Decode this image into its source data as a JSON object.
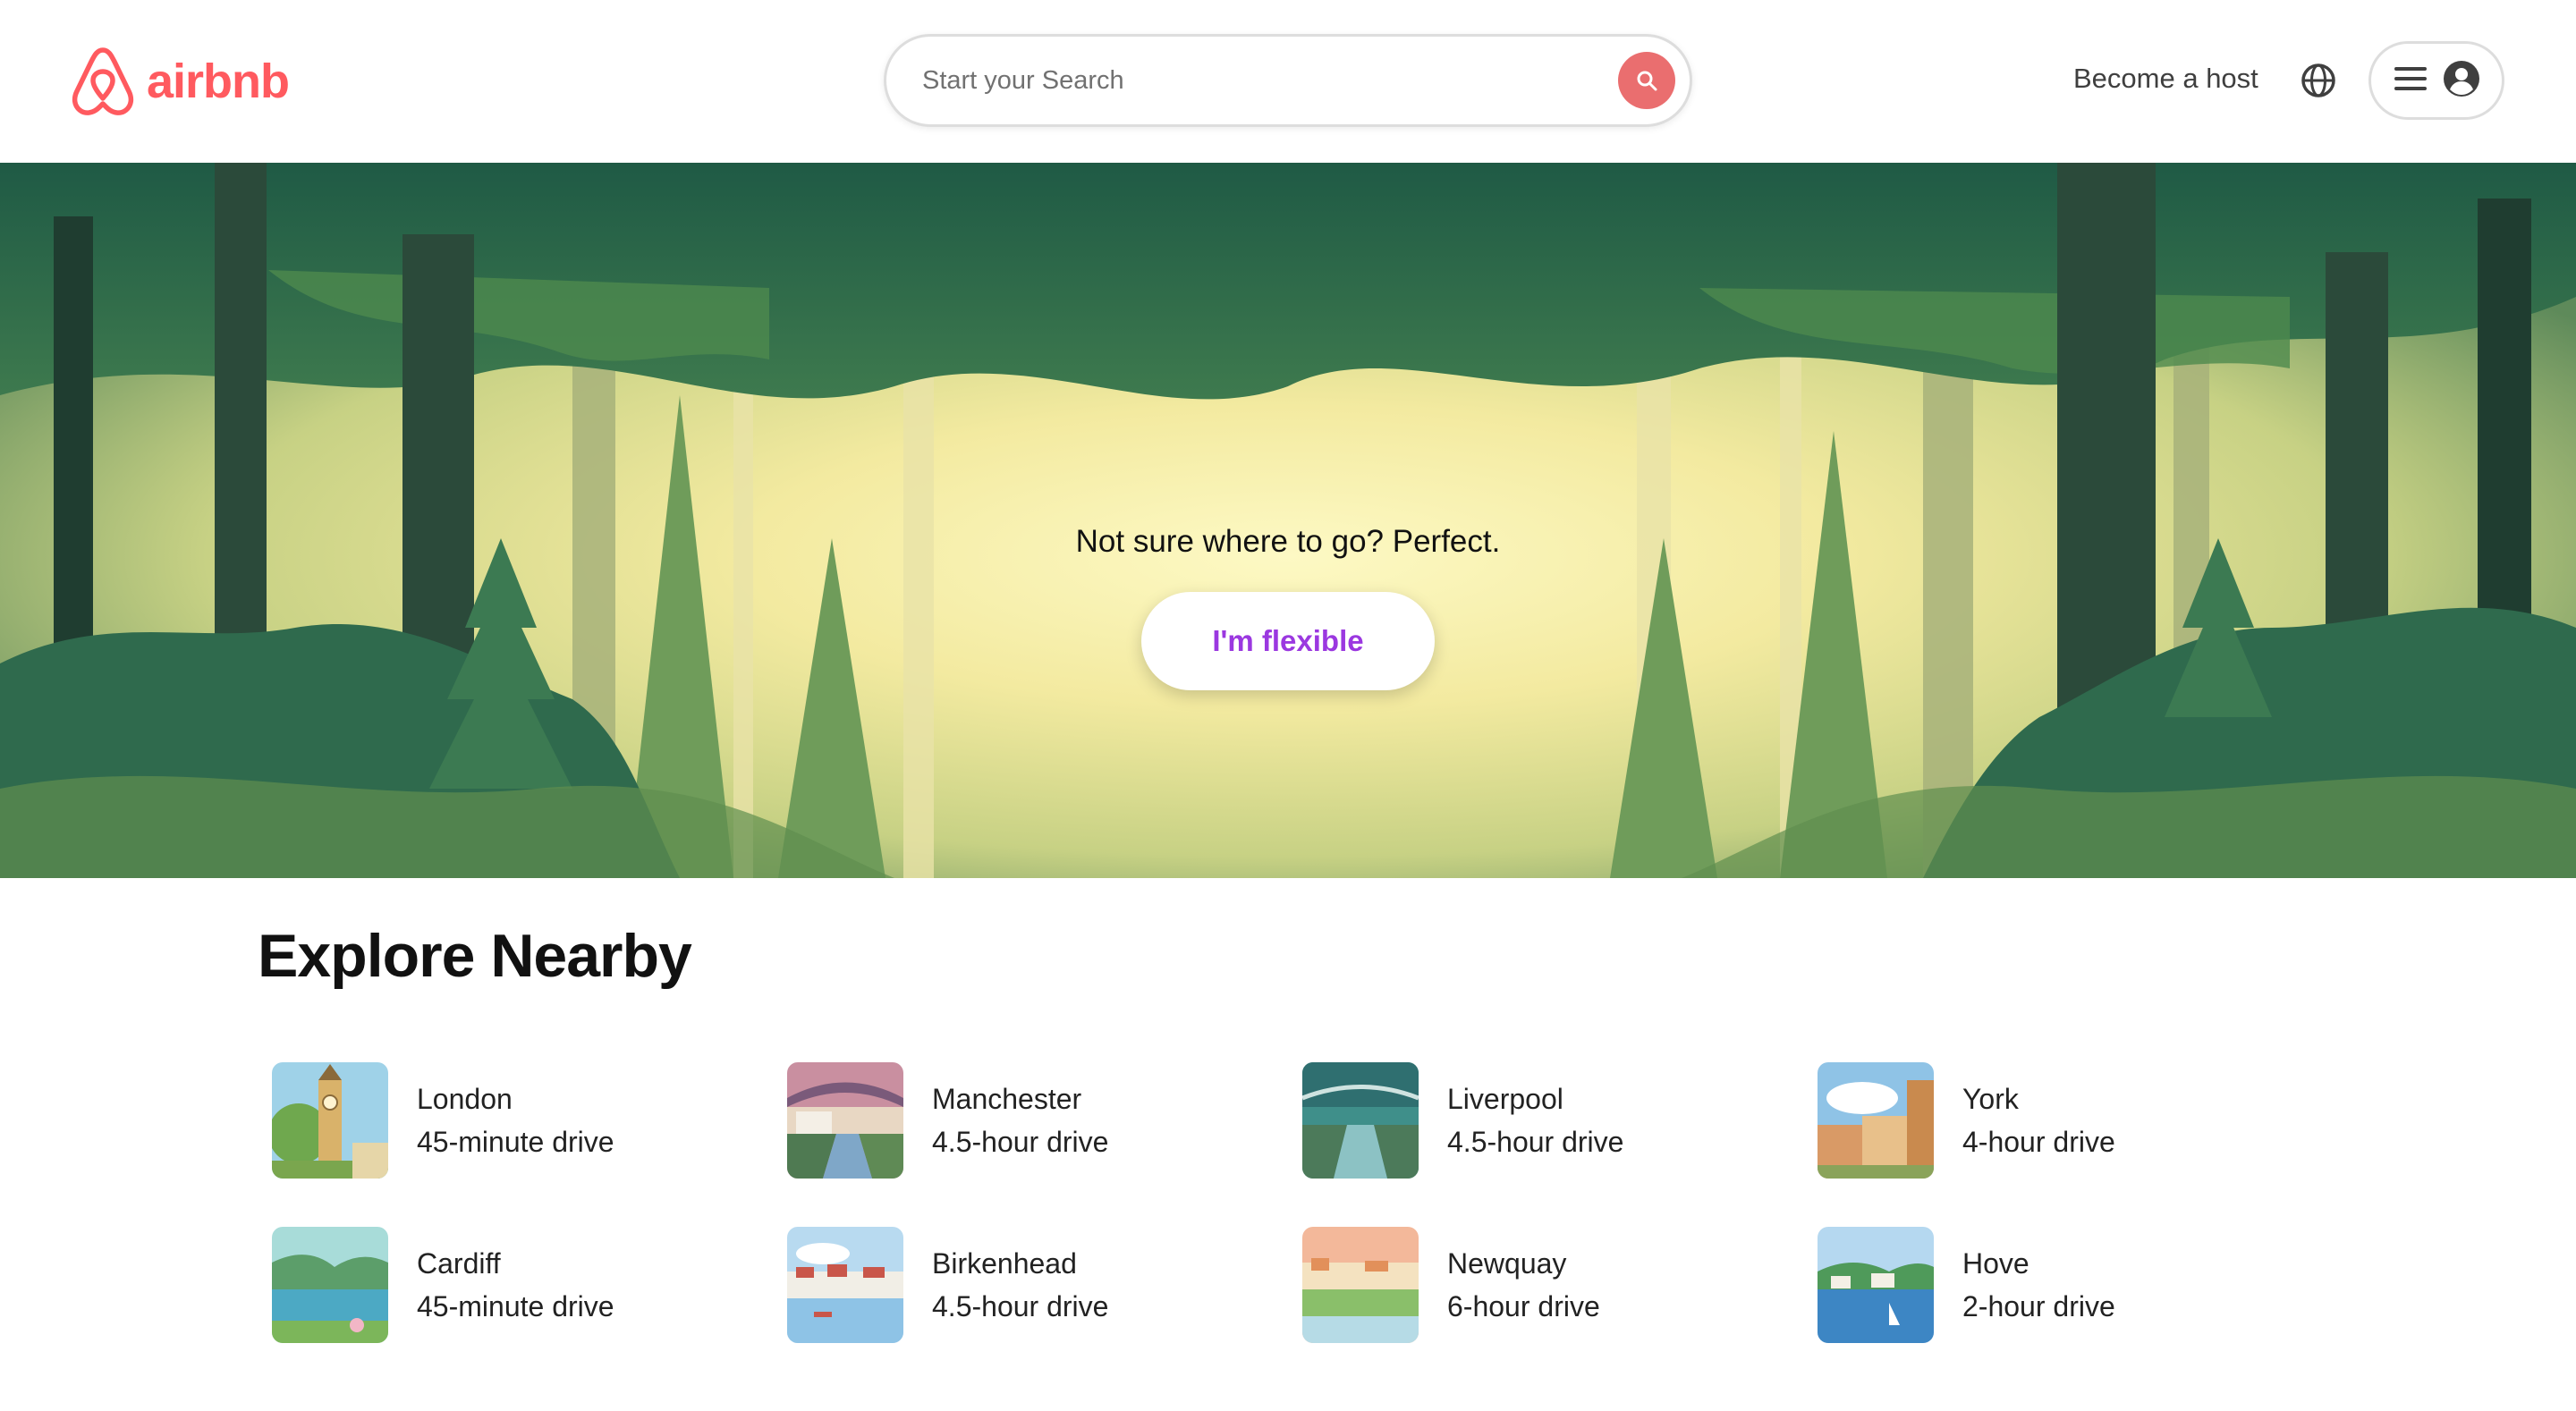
{
  "brand": {
    "name": "airbnb",
    "color": "#ff5a5f"
  },
  "search": {
    "placeholder": "Start your Search",
    "button_icon": "search-icon"
  },
  "nav": {
    "host_label": "Become a host",
    "globe_icon": "globe-icon",
    "menu_icon": "menu-icon",
    "avatar_icon": "user-avatar-icon"
  },
  "hero": {
    "title": "Not sure where to go? Perfect.",
    "cta_label": "I'm flexible",
    "cta_color": "#9b38e0"
  },
  "explore": {
    "title": "Explore Nearby",
    "items": [
      {
        "city": "London",
        "drive": "45-minute drive"
      },
      {
        "city": "Manchester",
        "drive": "4.5-hour drive"
      },
      {
        "city": "Liverpool",
        "drive": "4.5-hour drive"
      },
      {
        "city": "York",
        "drive": "4-hour drive"
      },
      {
        "city": "Cardiff",
        "drive": "45-minute drive"
      },
      {
        "city": "Birkenhead",
        "drive": "4.5-hour drive"
      },
      {
        "city": "Newquay",
        "drive": "6-hour drive"
      },
      {
        "city": "Hove",
        "drive": "2-hour drive"
      }
    ]
  }
}
